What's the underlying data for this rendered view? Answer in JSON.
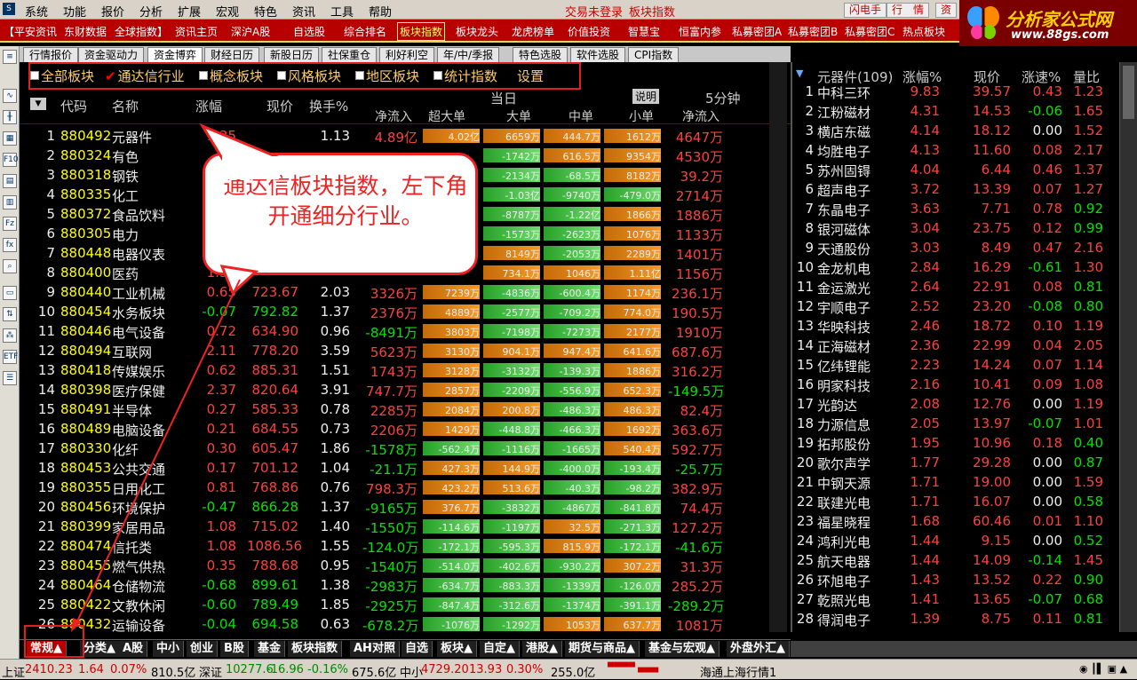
{
  "menubar": {
    "items": [
      "系统",
      "功能",
      "报价",
      "分析",
      "扩展",
      "宏观",
      "特色",
      "资讯",
      "工具",
      "帮助"
    ],
    "account_text": "交易未登录",
    "index_text": "板块指数",
    "buttons": [
      "闪电手",
      "行　情",
      "资"
    ]
  },
  "promo": {
    "items": [
      "【平安资讯",
      "东财数据",
      "全球指数】",
      "资讯主页",
      "深沪A股",
      "自选股",
      "综合排名",
      "板块指数",
      "板块龙头",
      "龙虎榜单",
      "价值投资",
      "智慧宝",
      "恒富内参",
      "私募密团A",
      "私募密团B",
      "私募密团C",
      "热点板块"
    ],
    "highlight_index": 7
  },
  "logo": {
    "title": "分析家公式网",
    "url": "www.88gs.com"
  },
  "toptabs": [
    "行情报价",
    "资金驱动力",
    "资金博弈",
    "财经日历",
    "新股日历",
    "社保重仓",
    "利好利空",
    "年/中/季报",
    "特色选股",
    "软件选股",
    "CPI指数"
  ],
  "active_toptab": 2,
  "filters": [
    {
      "label": "全部板块",
      "checked": false
    },
    {
      "label": "通达信行业",
      "checked": true
    },
    {
      "label": "概念板块",
      "checked": false
    },
    {
      "label": "风格板块",
      "checked": false
    },
    {
      "label": "地区板块",
      "checked": false
    },
    {
      "label": "统计指数",
      "checked": false
    },
    {
      "label": "设置",
      "checked": null
    }
  ],
  "table": {
    "headers": {
      "code": "代码",
      "name": "名称",
      "change": "涨幅",
      "price": "现价",
      "turnover": "换手%",
      "today": "当日",
      "net_inflow": "净流入",
      "super_large": "超大单",
      "large": "大单",
      "medium": "中单",
      "small": "小单",
      "explain": "说明",
      "five_min": "5分钟",
      "five_net": "净流入"
    },
    "rows": [
      {
        "no": "1",
        "code": "880492",
        "name": "元器件",
        "chg": "1.35",
        "price": "",
        "turn": "1.13",
        "net": "4.89亿",
        "sl": "4.02亿",
        "l": "6659万",
        "m": "444.7万",
        "s": "1612万",
        "fm": "4647万",
        "sd": 1,
        "ld": 1,
        "md": 1,
        "smd": 1,
        "fmd": 1
      },
      {
        "no": "2",
        "code": "880324",
        "name": "有色",
        "chg": "0.",
        "price": "",
        "turn": "",
        "net": "",
        "sl": "",
        "l": "-1742万",
        "m": "616.5万",
        "s": "9354万",
        "fm": "4530万",
        "sd": 0,
        "ld": -1,
        "md": 1,
        "smd": 1,
        "fmd": 1
      },
      {
        "no": "3",
        "code": "880318",
        "name": "钢铁",
        "chg": "",
        "price": "",
        "turn": "",
        "net": "",
        "sl": "",
        "l": "-2134万",
        "m": "-68.5万",
        "s": "8182万",
        "fm": "39.2万",
        "sd": 0,
        "ld": -1,
        "md": -1,
        "smd": 1,
        "fmd": 1
      },
      {
        "no": "4",
        "code": "880335",
        "name": "化工",
        "chg": "",
        "price": "",
        "turn": "",
        "net": "",
        "sl": "",
        "l": "-1.03亿",
        "m": "-9740万",
        "s": "-479.0万",
        "fm": "2714万",
        "sd": 0,
        "ld": -1,
        "md": -1,
        "smd": -1,
        "fmd": 1
      },
      {
        "no": "5",
        "code": "880372",
        "name": "食品饮料",
        "chg": "",
        "price": "",
        "turn": "",
        "net": "",
        "sl": "",
        "l": "-8787万",
        "m": "-1.22亿",
        "s": "1866万",
        "fm": "1886万",
        "sd": 0,
        "ld": -1,
        "md": -1,
        "smd": 1,
        "fmd": 1
      },
      {
        "no": "6",
        "code": "880305",
        "name": "电力",
        "chg": "",
        "price": "",
        "turn": "",
        "net": "",
        "sl": "",
        "l": "-1573万",
        "m": "-2623万",
        "s": "1076万",
        "fm": "1133万",
        "sd": 0,
        "ld": -1,
        "md": -1,
        "smd": 1,
        "fmd": 1
      },
      {
        "no": "7",
        "code": "880448",
        "name": "电器仪表",
        "chg": "",
        "price": "",
        "turn": "",
        "net": "",
        "sl": "",
        "l": "8149万",
        "m": "-2053万",
        "s": "2289万",
        "fm": "1401万",
        "sd": 0,
        "ld": 1,
        "md": -1,
        "smd": 1,
        "fmd": 1
      },
      {
        "no": "8",
        "code": "880400",
        "name": "医药",
        "chg": "1.36",
        "price": "",
        "turn": "",
        "net": "",
        "sl": "",
        "l": "734.1万",
        "m": "1046万",
        "s": "1.11亿",
        "fm": "1156万",
        "sd": 0,
        "ld": 1,
        "md": 1,
        "smd": 1,
        "fmd": 1
      },
      {
        "no": "9",
        "code": "880440",
        "name": "工业机械",
        "chg": "0.65",
        "price": "723.67",
        "turn": "2.03",
        "net": "3326万",
        "sl": "7239万",
        "l": "-4836万",
        "m": "-600.4万",
        "s": "1174万",
        "fm": "236.1万",
        "sd": 1,
        "ld": -1,
        "md": -1,
        "smd": 1,
        "fmd": 1
      },
      {
        "no": "10",
        "code": "880454",
        "name": "水务板块",
        "chg": "-0.07",
        "price": "792.82",
        "turn": "1.37",
        "net": "2376万",
        "sl": "4889万",
        "l": "-2577万",
        "m": "-709.2万",
        "s": "774.0万",
        "fm": "190.5万",
        "sd": 1,
        "ld": -1,
        "md": -1,
        "smd": 1,
        "fmd": 1
      },
      {
        "no": "11",
        "code": "880446",
        "name": "电气设备",
        "chg": "0.72",
        "price": "634.90",
        "turn": "0.96",
        "net": "-8491万",
        "sl": "3803万",
        "l": "-7198万",
        "m": "-7273万",
        "s": "2177万",
        "fm": "1910万",
        "sd": 1,
        "ld": -1,
        "md": -1,
        "smd": 1,
        "fmd": 1
      },
      {
        "no": "12",
        "code": "880494",
        "name": "互联网",
        "chg": "2.11",
        "price": "778.20",
        "turn": "3.59",
        "net": "5623万",
        "sl": "3130万",
        "l": "904.1万",
        "m": "947.4万",
        "s": "641.6万",
        "fm": "687.6万",
        "sd": 1,
        "ld": 1,
        "md": 1,
        "smd": 1,
        "fmd": 1
      },
      {
        "no": "13",
        "code": "880418",
        "name": "传媒娱乐",
        "chg": "0.62",
        "price": "885.31",
        "turn": "1.51",
        "net": "1743万",
        "sl": "3128万",
        "l": "-3132万",
        "m": "-139.3万",
        "s": "1886万",
        "fm": "316.2万",
        "sd": 1,
        "ld": -1,
        "md": -1,
        "smd": 1,
        "fmd": 1
      },
      {
        "no": "14",
        "code": "880398",
        "name": "医疗保健",
        "chg": "2.37",
        "price": "820.64",
        "turn": "3.91",
        "net": "747.7万",
        "sl": "2857万",
        "l": "-2209万",
        "m": "-556.9万",
        "s": "652.3万",
        "fm": "-149.5万",
        "sd": 1,
        "ld": -1,
        "md": -1,
        "smd": 1,
        "fmd": -1
      },
      {
        "no": "15",
        "code": "880491",
        "name": "半导体",
        "chg": "0.27",
        "price": "585.33",
        "turn": "0.78",
        "net": "2285万",
        "sl": "2084万",
        "l": "200.8万",
        "m": "-486.3万",
        "s": "486.3万",
        "fm": "82.4万",
        "sd": 1,
        "ld": 1,
        "md": -1,
        "smd": 1,
        "fmd": 1
      },
      {
        "no": "16",
        "code": "880489",
        "name": "电脑设备",
        "chg": "0.21",
        "price": "684.55",
        "turn": "0.73",
        "net": "2206万",
        "sl": "1429万",
        "l": "-448.8万",
        "m": "-466.3万",
        "s": "1692万",
        "fm": "363.6万",
        "sd": 1,
        "ld": -1,
        "md": -1,
        "smd": 1,
        "fmd": 1
      },
      {
        "no": "17",
        "code": "880330",
        "name": "化纤",
        "chg": "0.30",
        "price": "605.47",
        "turn": "1.86",
        "net": "-1578万",
        "sl": "-562.4万",
        "l": "-1116万",
        "m": "-1665万",
        "s": "540.4万",
        "fm": "592.7万",
        "sd": -1,
        "ld": -1,
        "md": -1,
        "smd": 1,
        "fmd": 1
      },
      {
        "no": "18",
        "code": "880453",
        "name": "公共交通",
        "chg": "0.17",
        "price": "701.12",
        "turn": "1.04",
        "net": "-21.1万",
        "sl": "427.3万",
        "l": "144.9万",
        "m": "-400.0万",
        "s": "-193.4万",
        "fm": "-25.7万",
        "sd": 1,
        "ld": 1,
        "md": -1,
        "smd": -1,
        "fmd": -1
      },
      {
        "no": "19",
        "code": "880355",
        "name": "日用化工",
        "chg": "0.81",
        "price": "768.86",
        "turn": "0.76",
        "net": "798.3万",
        "sl": "423.2万",
        "l": "513.6万",
        "m": "-40.3万",
        "s": "-98.2万",
        "fm": "382.9万",
        "sd": 1,
        "ld": 1,
        "md": -1,
        "smd": -1,
        "fmd": 1
      },
      {
        "no": "20",
        "code": "880456",
        "name": "环境保护",
        "chg": "-0.47",
        "price": "866.28",
        "turn": "1.37",
        "net": "-9165万",
        "sl": "376.7万",
        "l": "-3832万",
        "m": "-4867万",
        "s": "-841.8万",
        "fm": "74.4万",
        "sd": 1,
        "ld": -1,
        "md": -1,
        "smd": -1,
        "fmd": 1
      },
      {
        "no": "21",
        "code": "880399",
        "name": "家居用品",
        "chg": "1.08",
        "price": "715.02",
        "turn": "1.40",
        "net": "-1550万",
        "sl": "-114.6万",
        "l": "-1197万",
        "m": "32.5万",
        "s": "-271.3万",
        "fm": "127.2万",
        "sd": -1,
        "ld": -1,
        "md": 1,
        "smd": -1,
        "fmd": 1
      },
      {
        "no": "22",
        "code": "880474",
        "name": "信托类",
        "chg": "1.08",
        "price": "1086.56",
        "turn": "1.55",
        "net": "-124.0万",
        "sl": "-172.1万",
        "l": "-595.3万",
        "m": "815.9万",
        "s": "-172.1万",
        "fm": "-41.6万",
        "sd": -1,
        "ld": -1,
        "md": 1,
        "smd": -1,
        "fmd": -1
      },
      {
        "no": "23",
        "code": "880455",
        "name": "燃气供热",
        "chg": "0.35",
        "price": "788.68",
        "turn": "0.95",
        "net": "-1540万",
        "sl": "-514.0万",
        "l": "-402.6万",
        "m": "-930.2万",
        "s": "307.2万",
        "fm": "31.3万",
        "sd": -1,
        "ld": -1,
        "md": -1,
        "smd": 1,
        "fmd": 1
      },
      {
        "no": "24",
        "code": "880464",
        "name": "仓储物流",
        "chg": "-0.68",
        "price": "899.61",
        "turn": "1.38",
        "net": "-2983万",
        "sl": "-634.7万",
        "l": "-883.3万",
        "m": "-1339万",
        "s": "-126.0万",
        "fm": "285.2万",
        "sd": -1,
        "ld": -1,
        "md": -1,
        "smd": -1,
        "fmd": 1
      },
      {
        "no": "25",
        "code": "880422",
        "name": "文教休闲",
        "chg": "-0.60",
        "price": "789.49",
        "turn": "1.85",
        "net": "-2925万",
        "sl": "-847.4万",
        "l": "-312.6万",
        "m": "-1374万",
        "s": "-391.1万",
        "fm": "-289.2万",
        "sd": -1,
        "ld": -1,
        "md": -1,
        "smd": -1,
        "fmd": -1
      },
      {
        "no": "26",
        "code": "880432",
        "name": "运输设备",
        "chg": "-0.04",
        "price": "694.58",
        "turn": "0.63",
        "net": "-678.2万",
        "sl": "-1076万",
        "l": "-1292万",
        "m": "1053万",
        "s": "637.7万",
        "fm": "1081万",
        "sd": -1,
        "ld": -1,
        "md": 1,
        "smd": 1,
        "fmd": 1
      }
    ]
  },
  "right": {
    "headers": {
      "name": "元器件(109)",
      "chg": "涨幅%",
      "price": "现价",
      "speed": "涨速%",
      "ratio": "量比"
    },
    "rows": [
      [
        "1",
        "中科三环",
        "9.83",
        "39.57",
        "0.43",
        "1.23"
      ],
      [
        "2",
        "江粉磁材",
        "4.31",
        "14.53",
        "-0.06",
        "1.65"
      ],
      [
        "3",
        "横店东磁",
        "4.14",
        "18.12",
        "0.00",
        "1.52"
      ],
      [
        "4",
        "均胜电子",
        "4.13",
        "11.60",
        "0.08",
        "2.17"
      ],
      [
        "5",
        "苏州固锝",
        "4.04",
        "6.44",
        "0.46",
        "1.37"
      ],
      [
        "6",
        "超声电子",
        "3.72",
        "13.39",
        "0.07",
        "1.27"
      ],
      [
        "7",
        "东晶电子",
        "3.63",
        "7.71",
        "0.78",
        "0.92"
      ],
      [
        "8",
        "银河磁体",
        "3.04",
        "23.75",
        "0.12",
        "0.99"
      ],
      [
        "9",
        "天通股份",
        "3.03",
        "8.49",
        "0.47",
        "2.16"
      ],
      [
        "10",
        "金龙机电",
        "2.84",
        "16.29",
        "-0.61",
        "1.30"
      ],
      [
        "11",
        "金运激光",
        "2.64",
        "22.91",
        "0.08",
        "0.81"
      ],
      [
        "12",
        "宇顺电子",
        "2.52",
        "23.20",
        "-0.08",
        "0.80"
      ],
      [
        "13",
        "华映科技",
        "2.46",
        "18.72",
        "0.10",
        "1.19"
      ],
      [
        "14",
        "正海磁材",
        "2.36",
        "22.99",
        "0.04",
        "2.05"
      ],
      [
        "15",
        "亿纬锂能",
        "2.23",
        "14.24",
        "0.07",
        "1.14"
      ],
      [
        "16",
        "明家科技",
        "2.16",
        "10.41",
        "0.09",
        "1.08"
      ],
      [
        "17",
        "光韵达",
        "2.08",
        "12.76",
        "0.00",
        "1.19"
      ],
      [
        "18",
        "力源信息",
        "2.05",
        "13.97",
        "-0.07",
        "1.01"
      ],
      [
        "19",
        "拓邦股份",
        "1.95",
        "10.96",
        "0.18",
        "0.40"
      ],
      [
        "20",
        "歌尔声学",
        "1.77",
        "29.28",
        "0.00",
        "0.87"
      ],
      [
        "21",
        "中钢天源",
        "1.71",
        "19.00",
        "0.00",
        "1.59"
      ],
      [
        "22",
        "联建光电",
        "1.71",
        "16.07",
        "0.00",
        "0.58"
      ],
      [
        "23",
        "福星晓程",
        "1.68",
        "60.46",
        "0.01",
        "1.10"
      ],
      [
        "24",
        "鸿利光电",
        "1.44",
        "9.15",
        "0.00",
        "0.52"
      ],
      [
        "25",
        "航天电器",
        "1.44",
        "14.09",
        "-0.14",
        "1.45"
      ],
      [
        "26",
        "环旭电子",
        "1.43",
        "13.52",
        "0.22",
        "0.90"
      ],
      [
        "27",
        "乾照光电",
        "1.41",
        "13.65",
        "-0.07",
        "0.68"
      ],
      [
        "28",
        "得润电子",
        "1.39",
        "8.75",
        "0.11",
        "0.81"
      ]
    ]
  },
  "bottomtabs": [
    "常规▲",
    "分类▲",
    "A股",
    "中小",
    "创业",
    "B股",
    "基金",
    "板块指数",
    "AH对照",
    "自选",
    "板块▲",
    "自定▲",
    "港股▲",
    "期货与商品▲",
    "基金与宏观▲",
    "外盘外汇▲"
  ],
  "active_bottomtab": 0,
  "status": {
    "sh_label": "上证",
    "sh_val": "2410.23",
    "sh_chg": "1.64",
    "sh_pct": "0.07%",
    "sh_amt": "810.5亿",
    "sz_label": "深证",
    "sz_val": "10277.6",
    "sz_chg": "-16.96",
    "sz_pct": "-0.16%",
    "sz_amt": "675.6亿",
    "zx_label": "中小",
    "zx_val": "4729.20",
    "zx_chg": "13.93",
    "zx_pct": "0.30%",
    "zx_amt": "255.0亿",
    "source": "海通上海行情1"
  },
  "callout": {
    "text": "通达信板块指数，左下角开通细分行业。"
  },
  "colors": {
    "up": "#ff4040",
    "down": "#00e400",
    "accent": "#b80000"
  }
}
